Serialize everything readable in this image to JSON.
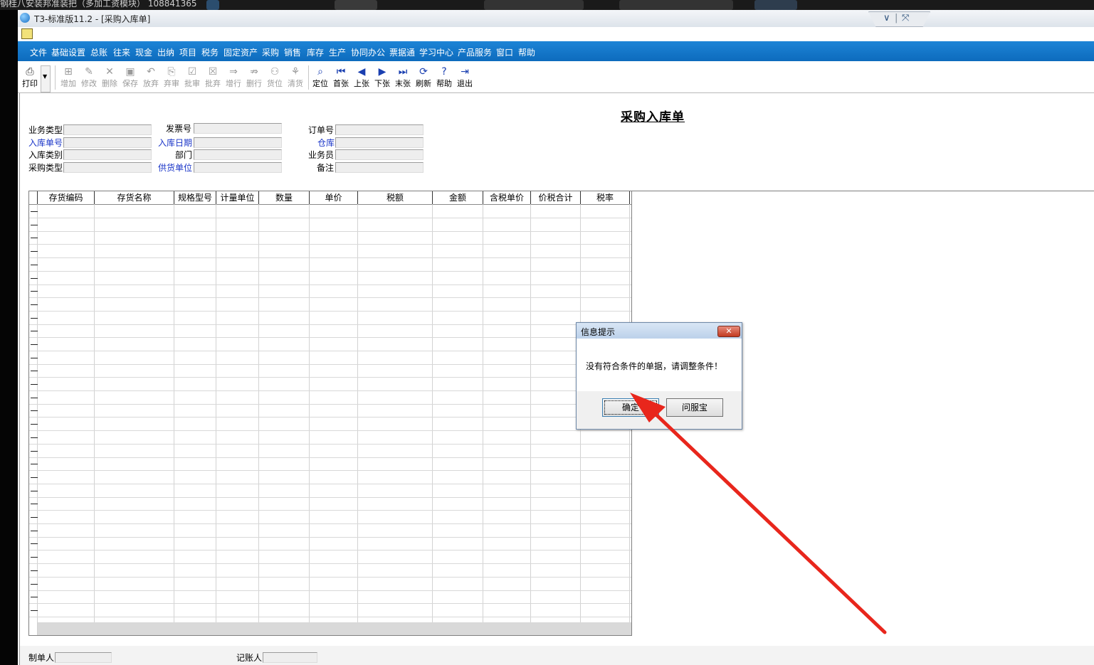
{
  "top_strip": {
    "text": "钢桂八安装邦准装把（多加工资模块） 108841365"
  },
  "window": {
    "title": "T3-标准版11.2 - [采购入库单]"
  },
  "menu": [
    "文件",
    "基础设置",
    "总账",
    "往来",
    "现金",
    "出纳",
    "项目",
    "税务",
    "固定资产",
    "采购",
    "销售",
    "库存",
    "生产",
    "协同办公",
    "票据通",
    "学习中心",
    "产品服务",
    "窗口",
    "帮助"
  ],
  "toolbar": {
    "print": "打印",
    "items": [
      {
        "label": "增加",
        "icon": "add-icon",
        "glyph": "⊞",
        "enabled": false
      },
      {
        "label": "修改",
        "icon": "edit-icon",
        "glyph": "✎",
        "enabled": false
      },
      {
        "label": "删除",
        "icon": "delete-icon",
        "glyph": "✕",
        "enabled": false
      },
      {
        "label": "保存",
        "icon": "save-icon",
        "glyph": "▣",
        "enabled": false
      },
      {
        "label": "放弃",
        "icon": "discard-icon",
        "glyph": "↶",
        "enabled": false
      },
      {
        "label": "弃审",
        "icon": "unapprove-icon",
        "glyph": "⎘",
        "enabled": false
      },
      {
        "label": "批审",
        "icon": "batch-approve-icon",
        "glyph": "☑",
        "enabled": false
      },
      {
        "label": "批弃",
        "icon": "batch-discard-icon",
        "glyph": "☒",
        "enabled": false
      },
      {
        "label": "增行",
        "icon": "add-row-icon",
        "glyph": "⇒",
        "enabled": false
      },
      {
        "label": "删行",
        "icon": "delete-row-icon",
        "glyph": "⇏",
        "enabled": false
      },
      {
        "label": "货位",
        "icon": "location-icon",
        "glyph": "⚇",
        "enabled": false
      },
      {
        "label": "清货",
        "icon": "clear-goods-icon",
        "glyph": "⚘",
        "enabled": false
      },
      {
        "label": "定位",
        "icon": "locate-icon",
        "glyph": "⌕",
        "enabled": true
      },
      {
        "label": "首张",
        "icon": "first-icon",
        "glyph": "⏮",
        "enabled": true
      },
      {
        "label": "上张",
        "icon": "prev-icon",
        "glyph": "◀",
        "enabled": true
      },
      {
        "label": "下张",
        "icon": "next-icon",
        "glyph": "▶",
        "enabled": true
      },
      {
        "label": "末张",
        "icon": "last-icon",
        "glyph": "⏭",
        "enabled": true
      },
      {
        "label": "刷新",
        "icon": "refresh-icon",
        "glyph": "⟳",
        "enabled": true
      },
      {
        "label": "帮助",
        "icon": "help-icon",
        "glyph": "?",
        "enabled": true
      },
      {
        "label": "退出",
        "icon": "exit-icon",
        "glyph": "⇥",
        "enabled": true
      }
    ]
  },
  "form": {
    "title": "采购入库单",
    "fields": {
      "business_type": {
        "label": "业务类型",
        "value": ""
      },
      "receipt_no": {
        "label": "入库单号",
        "value": ""
      },
      "receipt_category": {
        "label": "入库类别",
        "value": ""
      },
      "purchase_type": {
        "label": "采购类型",
        "value": ""
      },
      "invoice_no": {
        "label": "发票号",
        "value": ""
      },
      "receipt_date": {
        "label": "入库日期",
        "value": ""
      },
      "department": {
        "label": "部门",
        "value": ""
      },
      "supplier": {
        "label": "供货单位",
        "value": ""
      },
      "order_no": {
        "label": "订单号",
        "value": ""
      },
      "warehouse": {
        "label": "仓库",
        "value": ""
      },
      "salesperson": {
        "label": "业务员",
        "value": ""
      },
      "remark": {
        "label": "备注",
        "value": ""
      }
    },
    "link_color": "#1a35c8"
  },
  "grid": {
    "columns": [
      "存货编码",
      "存货名称",
      "规格型号",
      "计量单位",
      "数量",
      "单价",
      "税额",
      "金额",
      "含税单价",
      "价税合计",
      "税率"
    ],
    "rows": []
  },
  "footer": {
    "maker": {
      "label": "制单人",
      "value": ""
    },
    "bookkeeper": {
      "label": "记账人",
      "value": ""
    }
  },
  "dialog": {
    "title": "信息提示",
    "message": "没有符合条件的单据，请调整条件！",
    "ok": "确定",
    "service": "问服宝"
  },
  "colors": {
    "menubar": "#0d6bbd",
    "annotation_arrow": "#e8261c",
    "dialog_close": "#c23b22"
  }
}
